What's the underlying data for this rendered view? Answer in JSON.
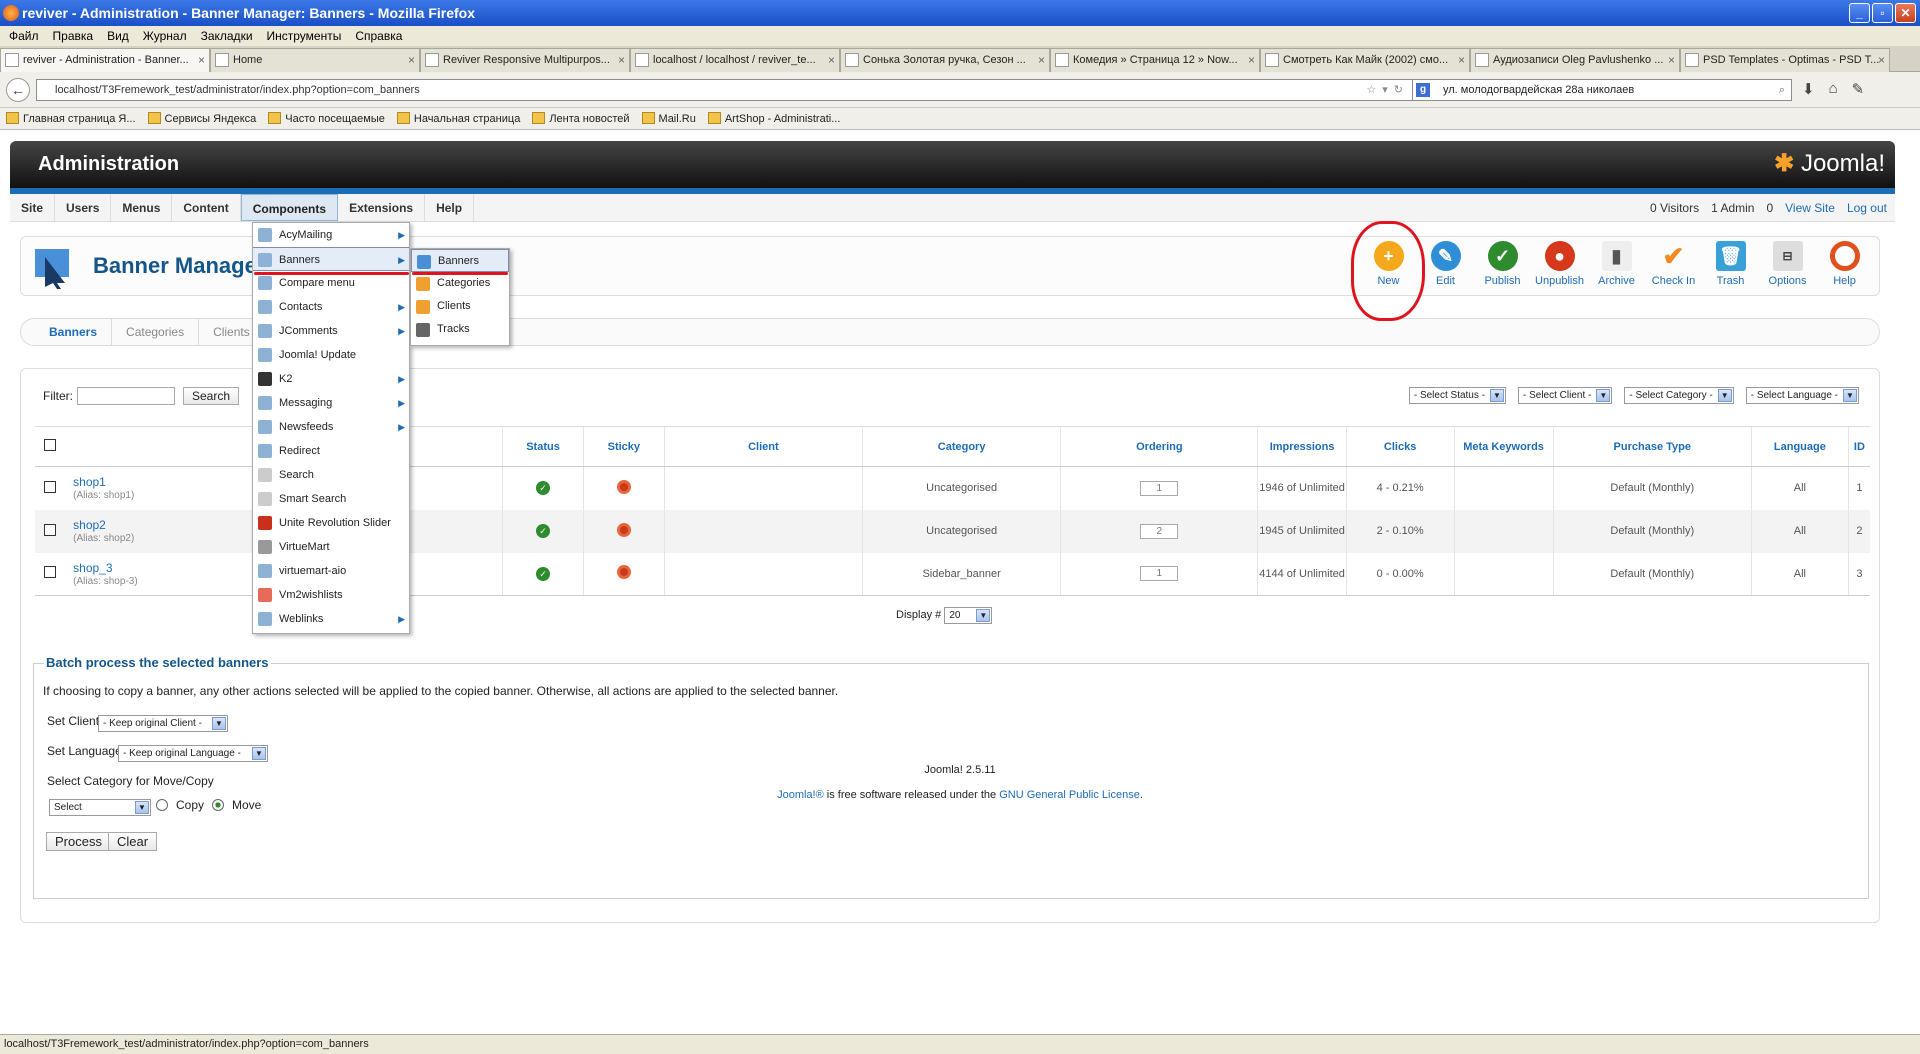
{
  "window": {
    "title": "reviver - Administration - Banner Manager: Banners - Mozilla Firefox"
  },
  "browser_menu": [
    "Файл",
    "Правка",
    "Вид",
    "Журнал",
    "Закладки",
    "Инструменты",
    "Справка"
  ],
  "tabs": [
    {
      "label": "reviver - Administration - Banner..."
    },
    {
      "label": "Home"
    },
    {
      "label": "Reviver Responsive Multipurpos..."
    },
    {
      "label": "localhost / localhost / reviver_te..."
    },
    {
      "label": "Сонька Золотая ручка, Сезон ..."
    },
    {
      "label": "Комедия » Страница 12 » Now..."
    },
    {
      "label": "Смотреть Как Майк (2002) смо..."
    },
    {
      "label": "Аудиозаписи Oleg Pavlushenko ..."
    },
    {
      "label": "PSD Templates - Optimas - PSD T..."
    }
  ],
  "url": "localhost/T3Fremework_test/administrator/index.php?option=com_banners",
  "search_value": "ул. молодогвардейская 28а николаев",
  "bookmarks": [
    "Главная страница Я...",
    "Сервисы Яндекса",
    "Часто посещаемые",
    "Начальная страница",
    "Лента новостей",
    "Mail.Ru",
    "ArtShop - Administrati..."
  ],
  "admin": {
    "title": "Administration",
    "logo": "Joomla!",
    "menu": [
      "Site",
      "Users",
      "Menus",
      "Content",
      "Components",
      "Extensions",
      "Help"
    ],
    "status": {
      "visitors": "0 Visitors",
      "admins": "1 Admin",
      "messages": "0",
      "view_site": "View Site",
      "logout": "Log out"
    }
  },
  "page_title": "Banner Manage",
  "toolbar": [
    {
      "label": "New",
      "icon": "plus-icon",
      "color": "#f5a81c"
    },
    {
      "label": "Edit",
      "icon": "pencil-icon",
      "color": "#2f8fd6"
    },
    {
      "label": "Publish",
      "icon": "check-icon",
      "color": "#2e8b2e"
    },
    {
      "label": "Unpublish",
      "icon": "stop-icon",
      "color": "#d6381c"
    },
    {
      "label": "Archive",
      "icon": "archive-icon",
      "color": "#777777"
    },
    {
      "label": "Check In",
      "icon": "checkmark-icon",
      "color": "#f08a1c"
    },
    {
      "label": "Trash",
      "icon": "trash-icon",
      "color": "#3aa0d8"
    },
    {
      "label": "Options",
      "icon": "options-icon",
      "color": "#999999"
    },
    {
      "label": "Help",
      "icon": "lifebuoy-icon",
      "color": "#e0501c"
    }
  ],
  "subtabs": [
    "Banners",
    "Categories",
    "Clients"
  ],
  "filter": {
    "label": "Filter:",
    "search_button": "Search"
  },
  "selects": [
    "- Select Status -",
    "- Select Client -",
    "- Select Category -",
    "- Select Language -"
  ],
  "columns": [
    "Status",
    "Sticky",
    "Client",
    "Category",
    "Ordering",
    "Impressions",
    "Clicks",
    "Meta Keywords",
    "Purchase Type",
    "Language",
    "ID"
  ],
  "rows": [
    {
      "name": "shop1",
      "alias": "shop1",
      "category": "Uncategorised",
      "ordering": "1",
      "impressions": "1946 of Unlimited",
      "clicks": "4 - 0.21%",
      "purchase": "Default (Monthly)",
      "language": "All",
      "id": "1"
    },
    {
      "name": "shop2",
      "alias": "shop2",
      "category": "Uncategorised",
      "ordering": "2",
      "impressions": "1945 of Unlimited",
      "clicks": "2 - 0.10%",
      "purchase": "Default (Monthly)",
      "language": "All",
      "id": "2"
    },
    {
      "name": "shop_3",
      "alias": "shop-3",
      "category": "Sidebar_banner",
      "ordering": "1",
      "impressions": "4144 of Unlimited",
      "clicks": "0 - 0.00%",
      "purchase": "Default (Monthly)",
      "language": "All",
      "id": "3"
    }
  ],
  "alias_label": "Alias:",
  "display": {
    "label": "Display #",
    "value": "20"
  },
  "batch": {
    "legend": "Batch process the selected banners",
    "desc": "If choosing to copy a banner, any other actions selected will be applied to the copied banner. Otherwise, all actions are applied to the selected banner.",
    "set_client": "Set Client",
    "client_select": "- Keep original Client -",
    "set_language": "Set Language",
    "language_select": "- Keep original Language -",
    "category_label": "Select Category for Move/Copy",
    "category_select": "Select",
    "copy": "Copy",
    "move": "Move",
    "process": "Process",
    "clear": "Clear"
  },
  "components_menu": [
    {
      "label": "AcyMailing",
      "sub": true
    },
    {
      "label": "Banners",
      "sub": true
    },
    {
      "label": "Compare menu",
      "sub": false
    },
    {
      "label": "Contacts",
      "sub": true
    },
    {
      "label": "JComments",
      "sub": true
    },
    {
      "label": "Joomla! Update",
      "sub": false
    },
    {
      "label": "K2",
      "sub": true
    },
    {
      "label": "Messaging",
      "sub": true
    },
    {
      "label": "Newsfeeds",
      "sub": true
    },
    {
      "label": "Redirect",
      "sub": false
    },
    {
      "label": "Search",
      "sub": false
    },
    {
      "label": "Smart Search",
      "sub": false
    },
    {
      "label": "Unite Revolution Slider",
      "sub": false
    },
    {
      "label": "VirtueMart",
      "sub": false
    },
    {
      "label": "virtuemart-aio",
      "sub": false
    },
    {
      "label": "Vm2wishlists",
      "sub": false
    },
    {
      "label": "Weblinks",
      "sub": true
    }
  ],
  "banners_submenu": [
    "Banners",
    "Categories",
    "Clients",
    "Tracks"
  ],
  "footer": {
    "version": "Joomla! 2.5.11",
    "license_pre": "Joomla!®",
    "license_mid": " is free software released under the ",
    "license_link": "GNU General Public License",
    "license_end": "."
  },
  "statusbar": "localhost/T3Fremework_test/administrator/index.php?option=com_banners"
}
